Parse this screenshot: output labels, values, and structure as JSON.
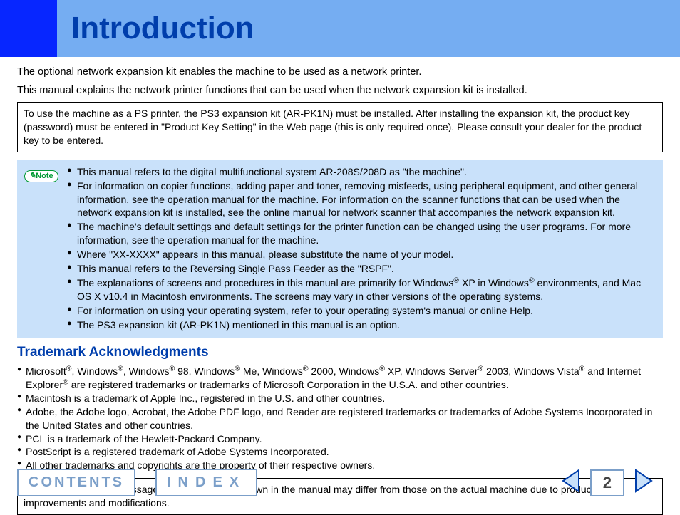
{
  "header": {
    "title": "Introduction"
  },
  "intro": {
    "p1": "The optional network expansion kit enables the machine to be used as a network printer.",
    "p2": "This manual explains the network printer functions that can be used when the network expansion kit is installed."
  },
  "ps_box": "To use the machine as a PS printer, the PS3 expansion kit (AR-PK1N) must be installed. After installing the expansion kit, the product key (password) must be entered in \"Product Key Setting\" in the Web page (this is only required once). Please consult your dealer for the product key to be entered.",
  "note_label": "Note",
  "notes": {
    "n0": "This manual refers to the digital multifunctional system AR-208S/208D as \"the machine\".",
    "n1": "For information on copier functions, adding paper and toner, removing misfeeds, using peripheral equipment, and other general information, see the operation manual for the machine. For information on the scanner functions that can be used when the network expansion kit is installed, see the online manual for network scanner that accompanies the network expansion kit.",
    "n2": "The machine's default settings and default settings for the printer function can be changed using the user programs. For more information, see the operation manual for the machine.",
    "n3": "Where \"XX-XXXX\" appears in this manual, please substitute the name of your model.",
    "n4": "This manual refers to the Reversing Single Pass Feeder as the \"RSPF\".",
    "n5_a": "The explanations of screens and procedures in this manual are primarily for Windows",
    "n5_b": " XP in Windows",
    "n5_c": " environments, and Mac OS X v10.4 in Macintosh environments. The screens may vary in other versions of the operating systems.",
    "n6": "For information on using your operating system, refer to your operating system's manual or online Help.",
    "n7": "The PS3 expansion kit (AR-PK1N) mentioned in this manual is an option."
  },
  "tm_title": "Trademark Acknowledgments",
  "tm": {
    "t0_a": "Microsoft",
    "t0_b": ", Windows",
    "t0_c": ", Windows",
    "t0_d": " 98, Windows",
    "t0_e": " Me, Windows",
    "t0_f": " 2000, Windows",
    "t0_g": " XP, Windows Server",
    "t0_h": " 2003, Windows Vista",
    "t0_i": " and Internet Explorer",
    "t0_j": " are registered trademarks or trademarks of Microsoft Corporation in the U.S.A. and other countries.",
    "t1": "Macintosh is a trademark of Apple Inc., registered in the U.S. and other countries.",
    "t2": "Adobe, the Adobe logo, Acrobat, the Adobe PDF logo, and Reader are registered trademarks or trademarks of Adobe Systems Incorporated in the United States and other countries.",
    "t3": "PCL is a trademark of the Hewlett-Packard Company.",
    "t4": "PostScript is a registered trademark of Adobe Systems Incorporated.",
    "t5": "All other trademarks and copyrights are the property of their respective owners."
  },
  "disclaimer": "The display screens, messages, and key names shown in the manual may differ from those on the actual machine due to product improvements and modifications.",
  "footer": {
    "contents": "CONTENTS",
    "index": "INDEX",
    "page": "2"
  },
  "reg": "®"
}
